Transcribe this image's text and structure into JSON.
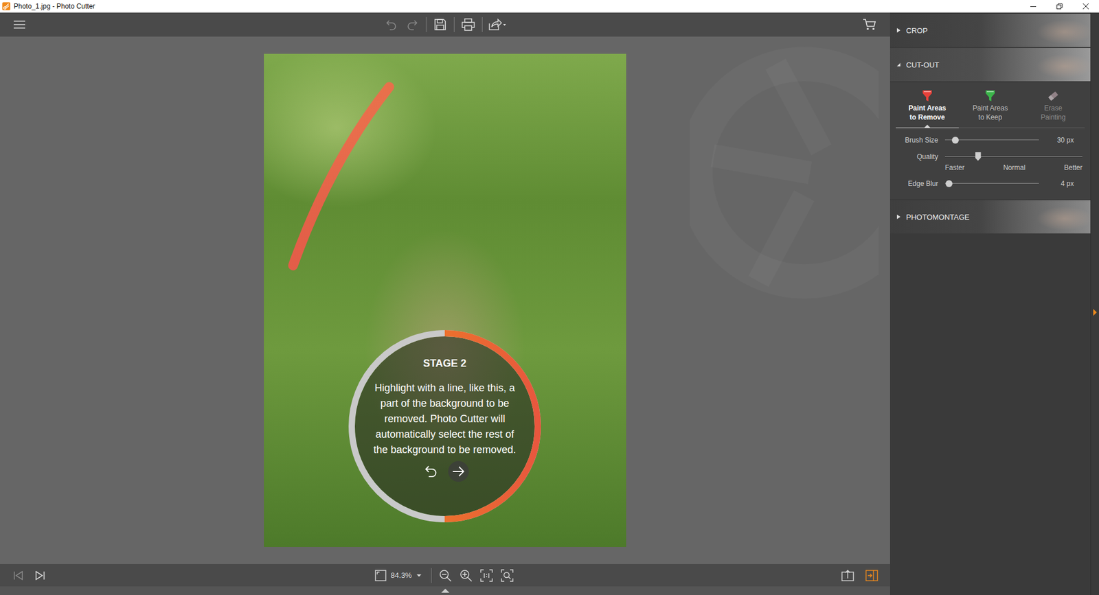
{
  "window": {
    "title": "Photo_1.jpg - Photo Cutter"
  },
  "toolbar": [
    {
      "kind": "undo",
      "disabled": true
    },
    {
      "kind": "redo",
      "disabled": true
    },
    {
      "kind": "save",
      "disabled": false
    },
    {
      "kind": "print",
      "disabled": false
    },
    {
      "kind": "share",
      "disabled": false
    }
  ],
  "canvas": {
    "zoom": "84.3%"
  },
  "tutorial": {
    "title": "STAGE 2",
    "text": "Highlight with a line, like this, a part of the background to be removed. Photo Cutter will automatically select the rest of the background to be removed.",
    "progress": 0.5
  },
  "panel": {
    "sections": [
      {
        "label": "CROP",
        "expanded": false
      },
      {
        "label": "CUT-OUT",
        "expanded": true
      },
      {
        "label": "PHOTOMONTAGE",
        "expanded": false
      }
    ],
    "tools": [
      {
        "kind": "remove",
        "lines": [
          "Paint Areas",
          "to Remove"
        ],
        "selected": true,
        "disabled": false,
        "color": "#e8413a"
      },
      {
        "kind": "keep",
        "lines": [
          "Paint Areas",
          "to Keep"
        ],
        "selected": false,
        "disabled": false,
        "color": "#3bb54a"
      },
      {
        "kind": "erase",
        "lines": [
          "Erase",
          "Painting"
        ],
        "selected": false,
        "disabled": true,
        "color": "#b49ea6"
      }
    ],
    "sliders": [
      {
        "kind": "plain",
        "label": "Brush Size",
        "level": 0.11,
        "reading": "30 px"
      },
      {
        "kind": "marked",
        "label": "Quality",
        "level": 0.24,
        "marks": [
          "Faster",
          "Normal",
          "Better"
        ]
      },
      {
        "kind": "plain",
        "label": "Edge Blur",
        "level": 0.04,
        "reading": "4 px"
      }
    ]
  }
}
